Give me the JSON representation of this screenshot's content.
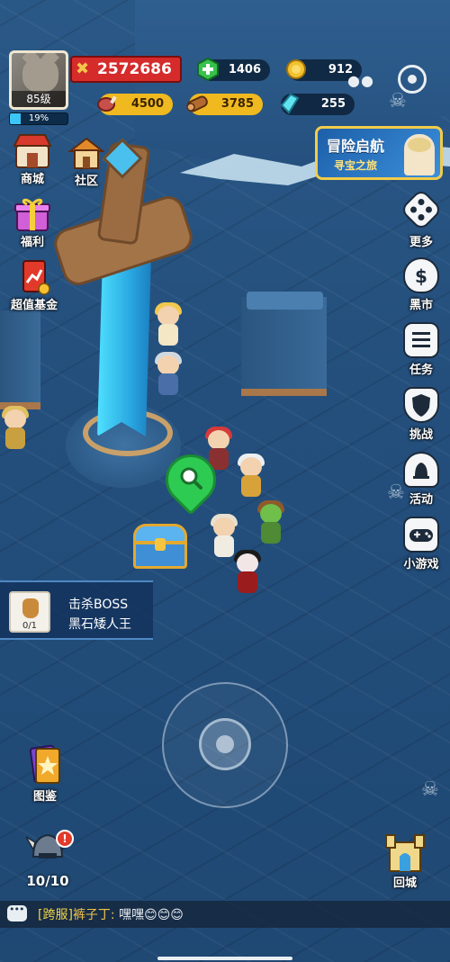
{
  "player": {
    "level": "85级",
    "xp_percent_label": "19%",
    "xp_fraction": 0.19
  },
  "resources": {
    "power": "2572686",
    "gems": "1406",
    "coins": "912",
    "meat": "4500",
    "wood": "3785",
    "crystals": "255"
  },
  "left_menu": {
    "shop": "商城",
    "community": "社区",
    "welfare": "福利",
    "fund": "超值基金",
    "codex": "图鉴"
  },
  "event_banner": {
    "title": "冒险启航",
    "subtitle": "寻宝之旅"
  },
  "right_menu": {
    "more": "更多",
    "black_market": "黑市",
    "tasks": "任务",
    "challenge": "挑战",
    "activity": "活动",
    "minigames": "小游戏",
    "return_city": "回城"
  },
  "quest": {
    "progress": "0/1",
    "line1": "击杀BOSS",
    "line2": "黑石矮人王"
  },
  "heroes": {
    "count": "10/10",
    "alert": "!"
  },
  "chat": {
    "channel": "[跨服]",
    "sender": "裤子丁:",
    "message": " 嘿嘿😊😊😊"
  },
  "colors": {
    "power_red": "#d52b2b",
    "resource_yellow": "#f0b920",
    "accent_gold": "#f2cc4a"
  },
  "icons": {
    "power": "crossed-swords-icon",
    "gems": "green-gem-plus-icon",
    "coins": "gold-coin-icon",
    "meat": "meat-icon",
    "wood": "log-icon",
    "crystals": "crystal-icon"
  }
}
